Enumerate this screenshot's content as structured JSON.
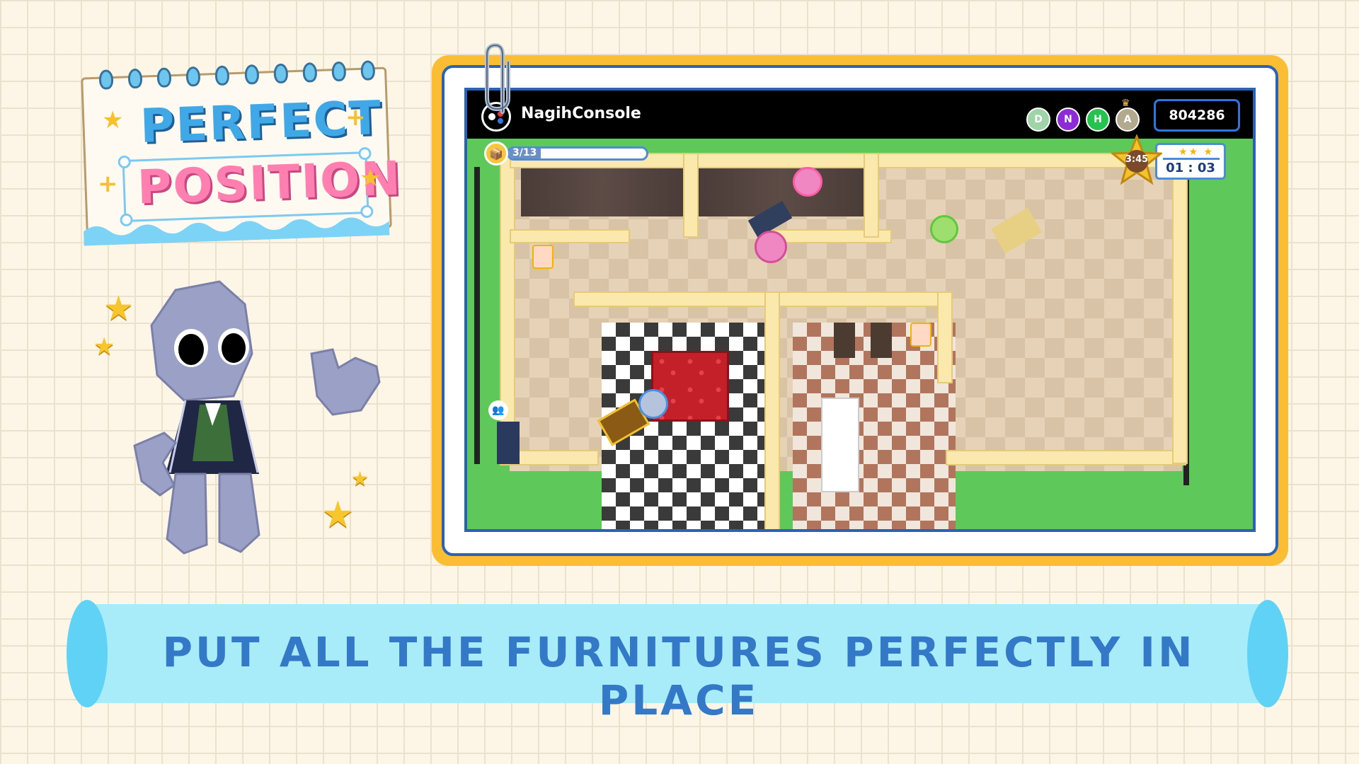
{
  "title": {
    "line1": "PERFECT",
    "line2": "POSITION"
  },
  "banner": {
    "text": "PUT ALL THE FURNITURES PERFECTLY IN PLACE"
  },
  "game": {
    "console_name": "NagihConsole",
    "badges": [
      {
        "label": "D",
        "color": "#9ed4a8"
      },
      {
        "label": "N",
        "color": "#8d2bd8"
      },
      {
        "label": "H",
        "color": "#25c250"
      },
      {
        "label": "A",
        "color": "#b3a98e"
      }
    ],
    "score": "804286",
    "furniture_progress": {
      "text": "3/13",
      "current": 3,
      "total": 13
    },
    "timer_star": "3:45",
    "timer": "01 : 03"
  },
  "icons": {
    "logo": "controller-logo-icon",
    "box": "box-icon",
    "crown": "crown-icon",
    "players": "players-icon"
  },
  "colors": {
    "accent": "#2b63b7",
    "frame": "#fbbd34",
    "banner": "#a8ecfa",
    "banner_text": "#3379c8"
  }
}
